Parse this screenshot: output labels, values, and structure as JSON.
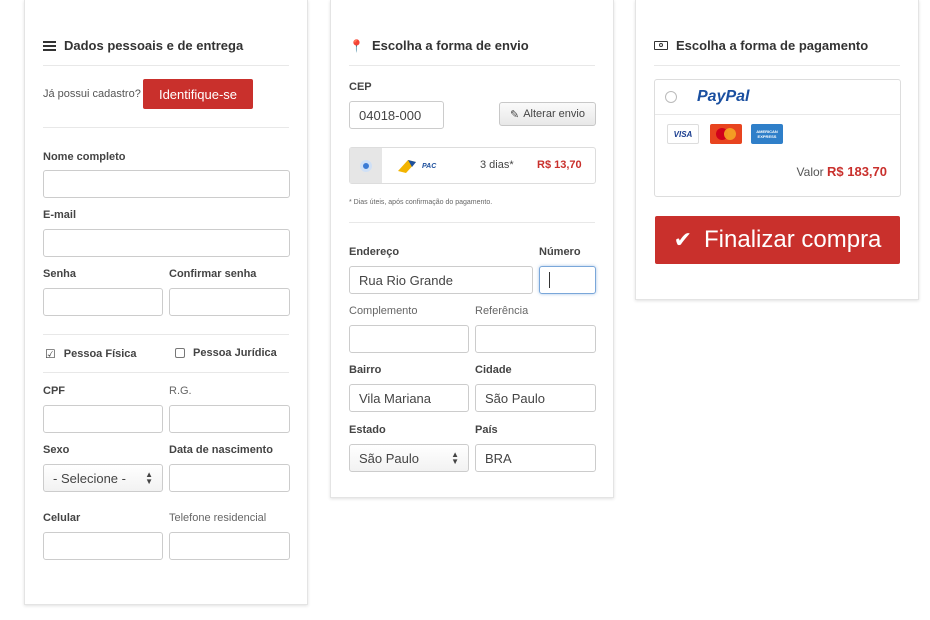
{
  "personal": {
    "title": "Dados pessoais e de entrega",
    "already_registered": "Já possui cadastro?",
    "identify_button": "Identifique-se",
    "full_name_label": "Nome completo",
    "email_label": "E-mail",
    "password_label": "Senha",
    "confirm_password_label": "Confirmar senha",
    "person_physical": "Pessoa Física",
    "person_legal": "Pessoa Jurídica",
    "cpf_label": "CPF",
    "rg_label": "R.G.",
    "sex_label": "Sexo",
    "sex_select_value": "- Selecione -",
    "birth_label": "Data de nascimento",
    "mobile_label": "Celular",
    "home_phone_label": "Telefone residencial"
  },
  "shipping": {
    "title": "Escolha a forma de envio",
    "cep_label": "CEP",
    "cep_value": "04018-000",
    "change_button": "Alterar envio",
    "option_brand": "PAC",
    "option_days": "3 dias*",
    "option_price": "R$ 13,70",
    "note": "* Dias úteis, após confirmação do pagamento.",
    "address_label": "Endereço",
    "number_label": "Número",
    "address_value": "Rua Rio Grande",
    "complement_label": "Complemento",
    "reference_label": "Referência",
    "district_label": "Bairro",
    "city_label": "Cidade",
    "district_value": "Vila Mariana",
    "city_value": "São Paulo",
    "state_label": "Estado",
    "country_label": "País",
    "state_value": "São Paulo",
    "country_value": "BRA"
  },
  "payment": {
    "title": "Escolha a forma de pagamento",
    "paypal_label": "PayPal",
    "card_visa": "VISA",
    "card_master": "MasterCard",
    "card_amex": "AMERICAN EXPRESS",
    "value_label": "Valor",
    "value_amount": "R$ 183,70",
    "finalize_button": "Finalizar compra"
  },
  "colors": {
    "accent_red": "#c9302c",
    "price_red": "#c9302c",
    "paypal_blue": "#1a4fa0"
  }
}
